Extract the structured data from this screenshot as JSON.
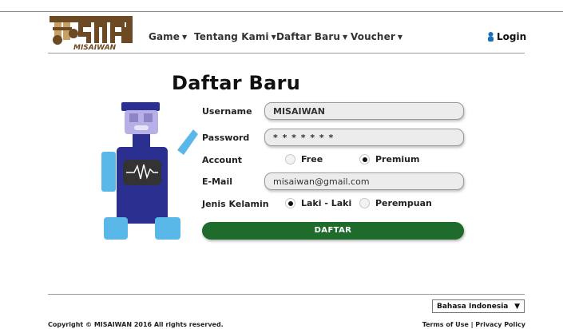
{
  "header": {
    "logo_text": "MISAIWAN",
    "nav": [
      {
        "label": "Game",
        "icon": "chevron-down-icon"
      },
      {
        "label": "Tentang Kami",
        "icon": "chevron-down-icon"
      },
      {
        "label": "Daftar Baru",
        "icon": "chevron-down-icon"
      },
      {
        "label": "Voucher",
        "icon": "chevron-down-icon"
      }
    ],
    "login_label": "Login",
    "login_icon": "user-icon"
  },
  "form": {
    "title": "Daftar Baru",
    "username_label": "Username",
    "username_value": "MISAIWAN",
    "password_label": "Password",
    "password_value": "* * * * * * *",
    "account_label": "Account",
    "account_options": [
      {
        "label": "Free",
        "selected": false
      },
      {
        "label": "Premium",
        "selected": true
      }
    ],
    "email_label": "E-Mail",
    "email_value": "misaiwan@gmail.com",
    "gender_label": "Jenis Kelamin",
    "gender_options": [
      {
        "label": "Laki - Laki",
        "selected": true
      },
      {
        "label": "Perempuan",
        "selected": false
      }
    ],
    "submit_label": "DAFTAR"
  },
  "footer": {
    "language": "Bahasa Indonesia",
    "copyright": "Copyright © MISAIWAN 2016 All rights reserved.",
    "links": "Terms of Use | Privacy Policy"
  },
  "colors": {
    "brand_brown": "#6b4a24",
    "button_green": "#1f6b2b",
    "robot_blue": "#2b2f8f",
    "robot_light_blue": "#5ab8e8",
    "robot_lavender": "#b7b0e6"
  }
}
